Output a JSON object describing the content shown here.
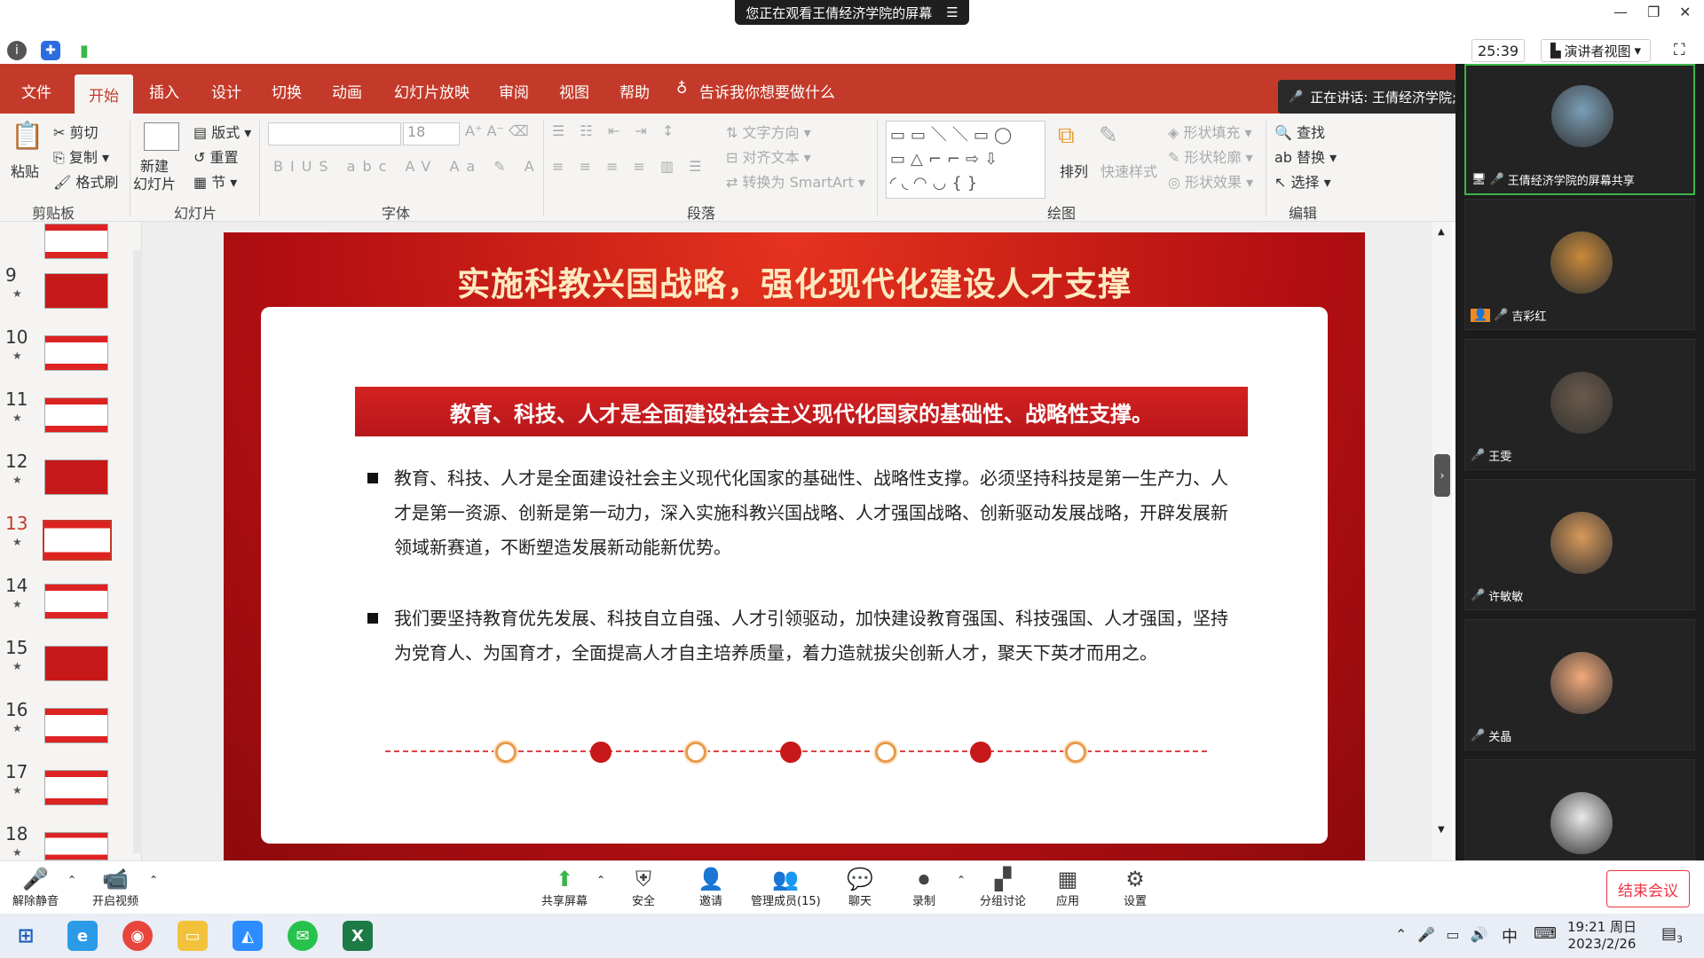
{
  "meeting": {
    "share_banner": "您正在观看王倩经济学院的屏幕",
    "timer": "25:39",
    "presenter_view": "演讲者视图",
    "speaking": "正在讲话: 王倩经济学院;"
  },
  "ppt": {
    "menu": [
      "文件",
      "开始",
      "插入",
      "设计",
      "切换",
      "动画",
      "幻灯片放映",
      "审阅",
      "视图",
      "帮助"
    ],
    "active_tab": "开始",
    "tell_me": "告诉我你想要做什么",
    "ribbon": {
      "paste": "粘贴",
      "cut": "剪切",
      "copy": "复制",
      "format_painter": "格式刷",
      "new_slide": "新建\n幻灯片",
      "layout": "版式",
      "reset": "重置",
      "section": "节",
      "font_size": "18",
      "text_direction": "文字方向",
      "align_text": "对齐文本",
      "convert_smartart": "转换为 SmartArt",
      "arrange": "排列",
      "quick_styles": "快速样式",
      "shape_fill": "形状填充",
      "shape_outline": "形状轮廓",
      "shape_effects": "形状效果",
      "find": "查找",
      "replace": "替换",
      "select": "选择",
      "groups": [
        "剪贴板",
        "幻灯片",
        "字体",
        "段落",
        "绘图",
        "编辑"
      ]
    },
    "slide_numbers": [
      "9",
      "10",
      "11",
      "12",
      "13",
      "14",
      "15",
      "16",
      "17",
      "18"
    ],
    "current_slide": "13",
    "slide": {
      "title": "实施科教兴国战略，强化现代化建设人才支撑",
      "banner": "教育、科技、人才是全面建设社会主义现代化国家的基础性、战略性支撑。",
      "para1": "教育、科技、人才是全面建设社会主义现代化国家的基础性、战略性支撑。必须坚持科技是第一生产力、人才是第一资源、创新是第一动力，深入实施科教兴国战略、人才强国战略、创新驱动发展战略，开辟发展新领域新赛道，不断塑造发展新动能新优势。",
      "para2": "我们要坚持教育优先发展、科技自立自强、人才引领驱动，加快建设教育强国、科技强国、人才强国，坚持为党育人、为国育才，全面提高人才自主培养质量，着力造就拔尖创新人才，聚天下英才而用之。"
    }
  },
  "participants": [
    {
      "name": "王倩经济学院的屏幕共享",
      "color": "#7a9fb8"
    },
    {
      "name": "吉彩红",
      "color": "#c98a3a"
    },
    {
      "name": "王雯",
      "color": "#6b5a4a"
    },
    {
      "name": "许敏敏",
      "color": "#d99a5a"
    },
    {
      "name": "关晶",
      "color": "#f2a97a"
    },
    {
      "name": "",
      "color": "#e9e9e9"
    }
  ],
  "toolbar": {
    "unmute": "解除静音",
    "start_video": "开启视频",
    "share": "共享屏幕",
    "security": "安全",
    "invite": "邀请",
    "participants": "管理成员(15)",
    "chat": "聊天",
    "record": "录制",
    "breakout": "分组讨论",
    "apps": "应用",
    "settings": "设置",
    "end": "结束会议"
  },
  "taskbar": {
    "ime": "中",
    "time": "19:21 周日",
    "date": "2023/2/26",
    "notif": "3"
  },
  "colors": {
    "accent": "#c43a2a",
    "slide_red": "#c8191a",
    "active_border": "#3ab54a",
    "end": "#e34"
  }
}
